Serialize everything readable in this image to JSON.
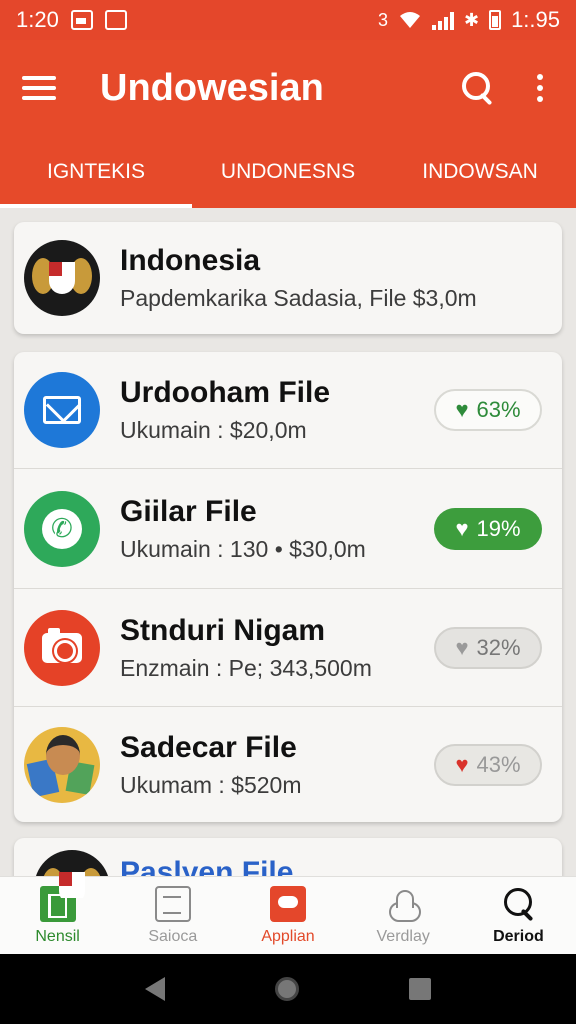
{
  "status_bar": {
    "time": "1:20",
    "right_text_1": "3",
    "right_text_2": "1:.95"
  },
  "app_bar": {
    "title": "Undowesian"
  },
  "tabs": [
    {
      "label": "IGNTEKIS",
      "active": true
    },
    {
      "label": "UNDONESNS",
      "active": false
    },
    {
      "label": "INDOWSAN",
      "active": false
    }
  ],
  "featured": {
    "title": "Indonesia",
    "subtitle": "Papdemkarika Sadasia, File $3,0m",
    "icon": "emblem-icon"
  },
  "list": [
    {
      "title": "Urdooham File",
      "subtitle": "Ukumain : $20,0m",
      "badge": "63%",
      "badge_style": "outline-green",
      "heart_color": "#2e8b3a",
      "icon": "mail-icon"
    },
    {
      "title": "Giilar File",
      "subtitle": "Ukumain : 130 • $30,0m",
      "badge": "19%",
      "badge_style": "solid-green",
      "heart_color": "#ffffff",
      "icon": "phone-icon"
    },
    {
      "title": "Stnduri Nigam",
      "subtitle": "Enzmain : Pe; 343,500m",
      "badge": "32%",
      "badge_style": "gray",
      "heart_color": "#9a9a9a",
      "icon": "camera-icon"
    },
    {
      "title": "Sadecar File",
      "subtitle": "Ukumam : $520m",
      "badge": "43%",
      "badge_style": "gray-red",
      "heart_color": "#d9332b",
      "icon": "collage-icon"
    }
  ],
  "peek_card": {
    "title": "Paslyen File"
  },
  "bottom_nav": [
    {
      "label": "Nensil",
      "icon": "book-icon"
    },
    {
      "label": "Saioca",
      "icon": "document-icon"
    },
    {
      "label": "Applian",
      "icon": "chat-icon"
    },
    {
      "label": "Verdlay",
      "icon": "cloud-icon"
    },
    {
      "label": "Deriod",
      "icon": "search-icon"
    }
  ],
  "colors": {
    "primary": "#e64a2a",
    "green": "#3d9d3d",
    "link_blue": "#2a62c8"
  }
}
